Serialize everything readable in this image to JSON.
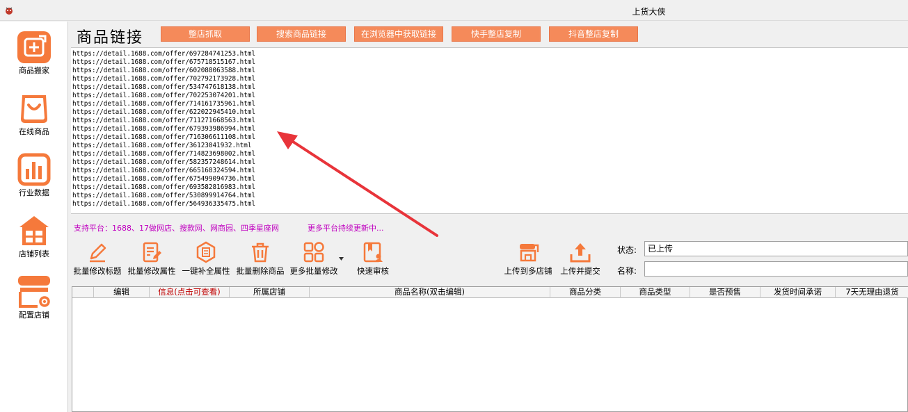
{
  "window": {
    "title": "上货大侠"
  },
  "sidebar": {
    "items": [
      {
        "label": "商品搬家",
        "icon": "move-products-icon"
      },
      {
        "label": "在线商品",
        "icon": "shopping-bag-icon"
      },
      {
        "label": "行业数据",
        "icon": "bar-chart-icon"
      },
      {
        "label": "店铺列表",
        "icon": "store-icon"
      },
      {
        "label": "配置店铺",
        "icon": "store-settings-icon"
      }
    ]
  },
  "header": {
    "title": "商品链接",
    "buttons": [
      "整店抓取",
      "搜索商品链接",
      "在浏览器中获取链接",
      "快手整店复制",
      "抖音整店复制"
    ]
  },
  "urls": [
    "https://detail.1688.com/offer/697284741253.html",
    "https://detail.1688.com/offer/675718515167.html",
    "https://detail.1688.com/offer/602088063588.html",
    "https://detail.1688.com/offer/702792173928.html",
    "https://detail.1688.com/offer/534747618138.html",
    "https://detail.1688.com/offer/702253074201.html",
    "https://detail.1688.com/offer/714161735961.html",
    "https://detail.1688.com/offer/622022945410.html",
    "https://detail.1688.com/offer/711271668563.html",
    "https://detail.1688.com/offer/679393986994.html",
    "https://detail.1688.com/offer/716306611108.html",
    "https://detail.1688.com/offer/36123041932.html",
    "https://detail.1688.com/offer/714823698002.html",
    "https://detail.1688.com/offer/582357248614.html",
    "https://detail.1688.com/offer/665168324594.html",
    "https://detail.1688.com/offer/675499094736.html",
    "https://detail.1688.com/offer/693582816983.html",
    "https://detail.1688.com/offer/530899914764.html",
    "https://detail.1688.com/offer/564936335475.html"
  ],
  "platforms": {
    "supported": "支持平台：1688、17做网店、搜款网、网商园、四季星座网",
    "more": "更多平台持续更新中..."
  },
  "toolbar": {
    "batch_edit_title": "批量修改标题",
    "batch_edit_attrs": "批量修改属性",
    "fill_attrs": "一键补全属性",
    "batch_delete": "批量删除商品",
    "more_batch": "更多批量修改",
    "quick_review": "快速审核",
    "upload_multi": "上传到多店铺",
    "upload_submit": "上传并提交"
  },
  "filters": {
    "status_label": "状态:",
    "status_value": "已上传",
    "name_label": "名称:",
    "name_value": ""
  },
  "grid": {
    "columns": [
      "编辑",
      "信息(点击可查看)",
      "所属店铺",
      "商品名称(双击编辑)",
      "商品分类",
      "商品类型",
      "是否预售",
      "发货时间承诺",
      "7天无理由退货"
    ]
  },
  "colors": {
    "accent": "#f58a5a",
    "brand_orange": "#f5793b",
    "platform_text": "#c000c0",
    "arrow": "#e8343a"
  }
}
